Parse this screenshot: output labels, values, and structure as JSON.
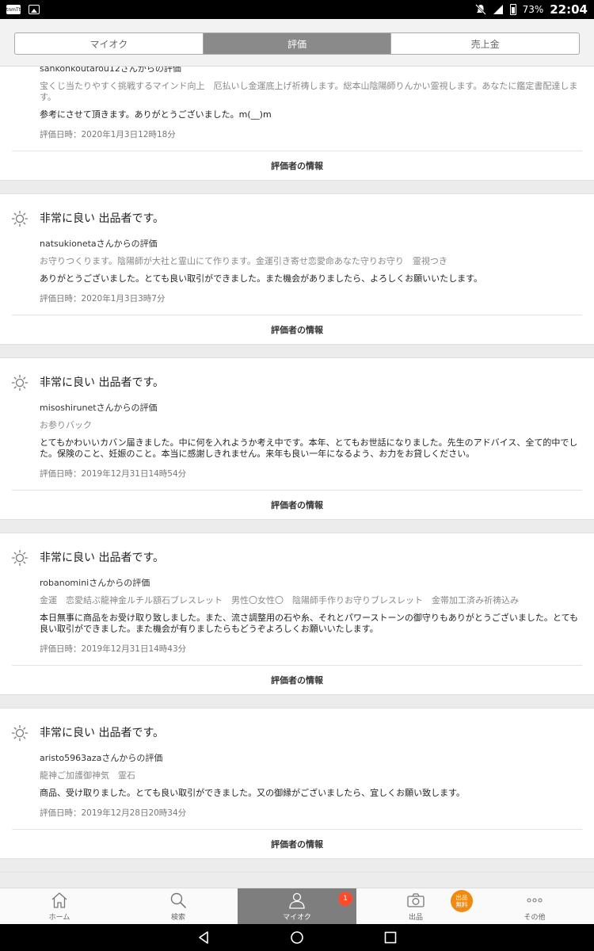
{
  "status_bar": {
    "app_icon_text": "tnmTt",
    "battery": "73%",
    "time": "22:04"
  },
  "tabs": [
    {
      "label": "マイオク",
      "active": false
    },
    {
      "label": "評価",
      "active": true
    },
    {
      "label": "売上金",
      "active": false
    }
  ],
  "partial_review": {
    "from": "sankonkoutarou12さんからの評価",
    "item": "宝くじ当たりやすく挑戦するマインド向上　厄払いし金運底上げ祈祷します。総本山陰陽師りんかい霊視します。あなたに鑑定書配達します。",
    "comment": "参考にさせて頂きます。ありがとうございました。m(__)m",
    "date": "評価日時：2020年1月3日12時18分",
    "reviewer_link": "評価者の情報"
  },
  "reviews": [
    {
      "rating": "非常に良い 出品者です。",
      "from": "natsukionetaさんからの評価",
      "item": "お守りつくります。陰陽師が大社と霊山にて作ります。金運引き寄せ恋愛命あなた守りお守り　霊視つき",
      "comment": "ありがとうございました。とても良い取引ができました。また機会がありましたら、よろしくお願いいたします。",
      "date": "評価日時：2020年1月3日3時7分",
      "reviewer_link": "評価者の情報"
    },
    {
      "rating": "非常に良い 出品者です。",
      "from": "misoshirunetさんからの評価",
      "item": "お参りバック",
      "comment": "とてもかわいいカバン届きました。中に何を入れようか考え中です。本年、とてもお世話になりました。先生のアドバイス、全て的中でした。保険のこと、妊娠のこと。本当に感謝しきれません。来年も良い一年になるよう、お力をお貸しください。",
      "date": "評価日時：2019年12月31日14時54分",
      "reviewer_link": "評価者の情報"
    },
    {
      "rating": "非常に良い 出品者です。",
      "from": "robanominiさんからの評価",
      "item": "金運　恋愛結ぶ龍神金ルチル額石ブレスレット　男性〇女性〇　陰陽師手作りお守りブレスレット　金帯加工済み祈祷込み",
      "comment": "本日無事に商品をお受け取り致しました。また、流さ調整用の石や糸、それとパワーストーンの御守りもありがとうございました。とても良い取引ができました。また機会が有りましたらもどうぞよろしくお願いいたします。",
      "date": "評価日時：2019年12月31日14時43分",
      "reviewer_link": "評価者の情報"
    },
    {
      "rating": "非常に良い 出品者です。",
      "from": "aristo5963azaさんからの評価",
      "item": "龍神ご加護御神気　霊石",
      "comment": "商品、受け取りました。とても良い取引ができました。又の御縁がございましたら、宜しくお願い致します。",
      "date": "評価日時：2019年12月28日20時34分",
      "reviewer_link": "評価者の情報"
    }
  ],
  "bottom_nav": {
    "home": "ホーム",
    "search": "検索",
    "myauc": "マイオク",
    "myauc_badge": "1",
    "sell": "出品",
    "sell_badge": "出品\n無料",
    "other": "その他"
  },
  "colors": {
    "active_tab": "#8a8a8a",
    "badge_red": "#ff4b2b",
    "badge_orange": "#f08a10"
  }
}
